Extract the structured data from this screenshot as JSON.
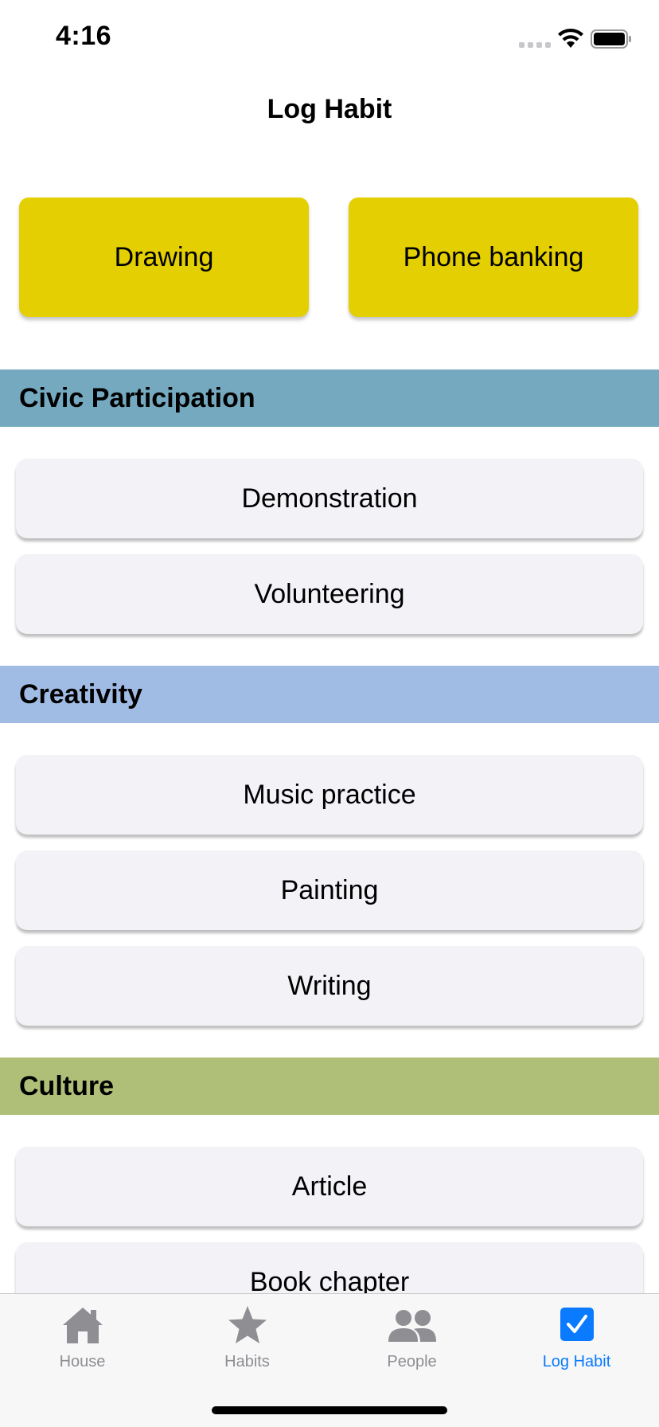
{
  "status_bar": {
    "time": "4:16"
  },
  "nav": {
    "title": "Log Habit"
  },
  "favorites": [
    {
      "label": "Drawing",
      "color": "#e3cf02"
    },
    {
      "label": "Phone banking",
      "color": "#e3cf02"
    }
  ],
  "sections": [
    {
      "title": "Civic Participation",
      "color": "#74a9bf",
      "items": [
        "Demonstration",
        "Volunteering"
      ]
    },
    {
      "title": "Creativity",
      "color": "#a1bce4",
      "items": [
        "Music practice",
        "Painting",
        "Writing"
      ]
    },
    {
      "title": "Culture",
      "color": "#b0bf78",
      "items": [
        "Article",
        "Book chapter"
      ]
    }
  ],
  "tabs": [
    {
      "label": "House",
      "icon": "house-icon",
      "active": false
    },
    {
      "label": "Habits",
      "icon": "star-icon",
      "active": false
    },
    {
      "label": "People",
      "icon": "people-icon",
      "active": false
    },
    {
      "label": "Log Habit",
      "icon": "checkbox-icon",
      "active": true
    }
  ],
  "colors": {
    "accent": "#0a7aff",
    "tab_inactive": "#8e8e93"
  }
}
